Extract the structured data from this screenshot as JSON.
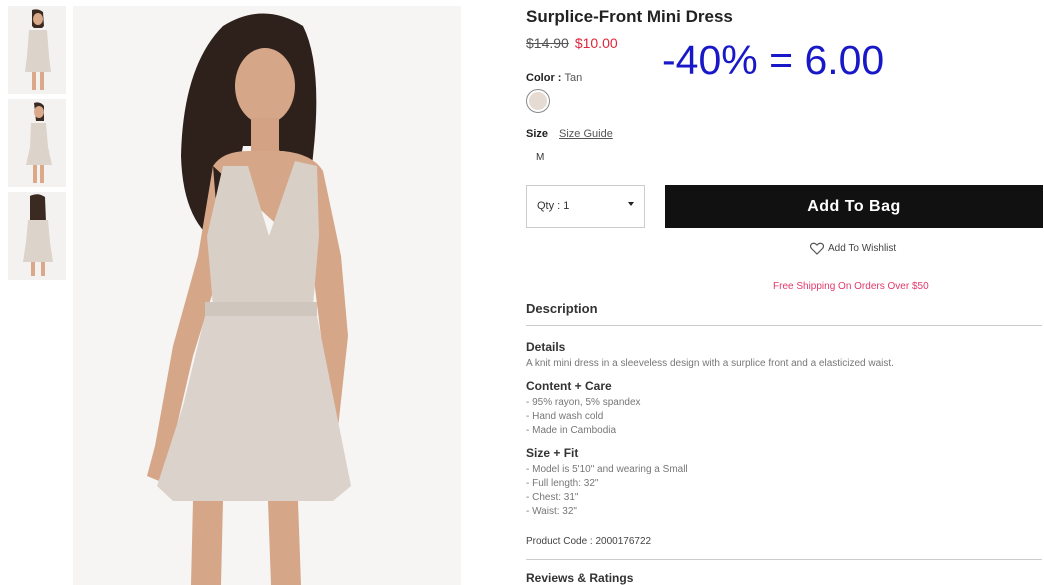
{
  "product": {
    "title": "Surplice-Front Mini Dress",
    "old_price": "$14.90",
    "new_price": "$10.00",
    "overlay_note": "-40% = 6.00"
  },
  "color": {
    "label": "Color :",
    "value": "Tan",
    "swatch_color": "#e5dbd2"
  },
  "size": {
    "label": "Size",
    "guide_link": "Size Guide",
    "options": [
      "M"
    ]
  },
  "qty": {
    "label": "Qty : 1"
  },
  "add_to_bag": "Add To Bag",
  "wishlist": "Add To Wishlist",
  "shipping_note": "Free Shipping On Orders Over $50",
  "description": {
    "heading": "Description",
    "details_title": "Details",
    "details_text": "A knit mini dress in a sleeveless design with a surplice front and a elasticized waist.",
    "content_title": "Content + Care",
    "content_lines": [
      "- 95% rayon, 5% spandex",
      "- Hand wash cold",
      "- Made in Cambodia"
    ],
    "fit_title": "Size + Fit",
    "fit_lines": [
      "- Model is 5'10\" and wearing a Small",
      "- Full length: 32\"",
      "- Chest: 31\"",
      "- Waist: 32\""
    ],
    "product_code": "Product Code : 2000176722"
  },
  "reviews_heading": "Reviews & Ratings",
  "colors": {
    "accent_red": "#e0263b",
    "overlay_blue": "#1818c8",
    "button_black": "#111111"
  }
}
